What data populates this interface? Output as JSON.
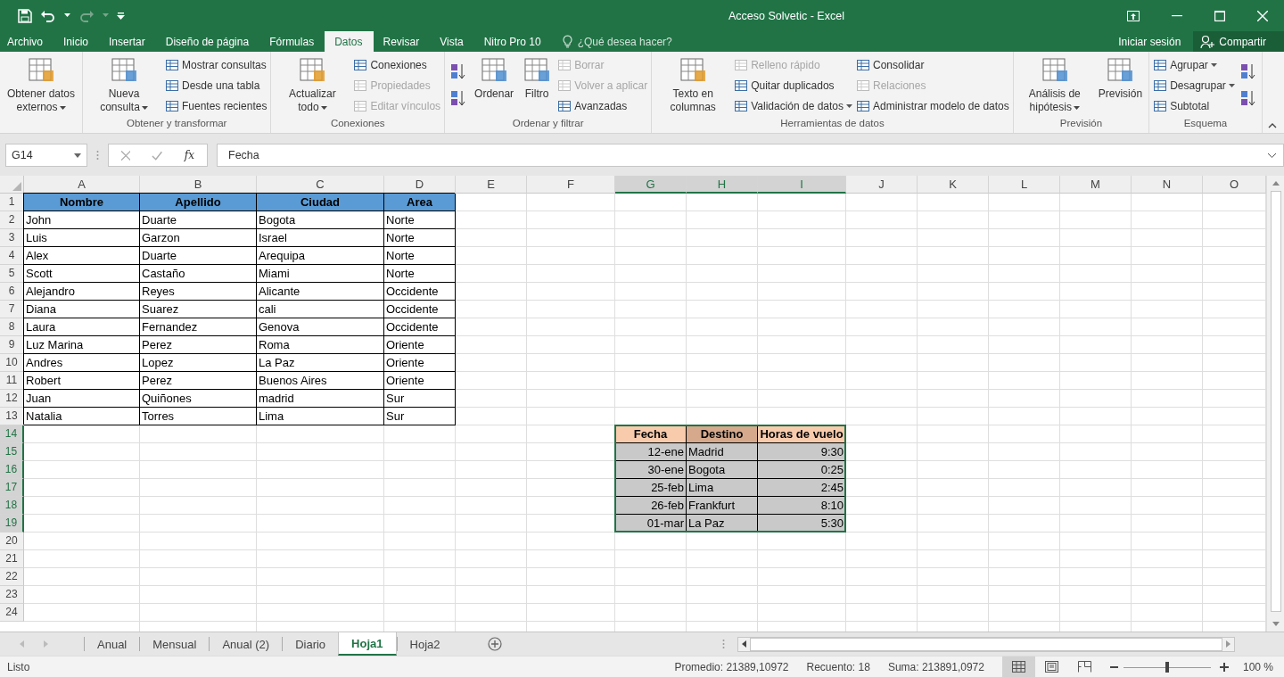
{
  "window": {
    "title": "Acceso Solvetic - Excel"
  },
  "ribbon_tabs": [
    {
      "label": "Archivo",
      "selected": false
    },
    {
      "label": "Inicio",
      "selected": false
    },
    {
      "label": "Insertar",
      "selected": false
    },
    {
      "label": "Diseño de página",
      "selected": false
    },
    {
      "label": "Fórmulas",
      "selected": false
    },
    {
      "label": "Datos",
      "selected": true
    },
    {
      "label": "Revisar",
      "selected": false
    },
    {
      "label": "Vista",
      "selected": false
    },
    {
      "label": "Nitro Pro 10",
      "selected": false
    }
  ],
  "tell_me": {
    "placeholder": "¿Qué desea hacer?"
  },
  "account": {
    "sign_in": "Iniciar sesión",
    "share": "Compartir"
  },
  "ribbon_groups": [
    {
      "columns": [
        {
          "kind": "large",
          "label": "Obtener datos externos",
          "dropdown": true,
          "disabled": false
        }
      ]
    },
    {
      "label": "Obtener y transformar",
      "columns": [
        {
          "kind": "large",
          "label": "Nueva consulta",
          "dropdown": true,
          "disabled": false
        },
        {
          "kind": "stack",
          "items": [
            {
              "label": "Mostrar consultas",
              "disabled": false,
              "dropdown": false
            },
            {
              "label": "Desde una tabla",
              "disabled": false,
              "dropdown": false
            },
            {
              "label": "Fuentes recientes",
              "disabled": false,
              "dropdown": false
            }
          ]
        }
      ]
    },
    {
      "label": "Conexiones",
      "columns": [
        {
          "kind": "large",
          "label": "Actualizar todo",
          "dropdown": true,
          "disabled": false
        },
        {
          "kind": "stack",
          "items": [
            {
              "label": "Conexiones",
              "disabled": false,
              "dropdown": false
            },
            {
              "label": "Propiedades",
              "disabled": true,
              "dropdown": false
            },
            {
              "label": "Editar vínculos",
              "disabled": true,
              "dropdown": false
            }
          ]
        }
      ]
    },
    {
      "label": "Ordenar y filtrar",
      "columns": [
        {
          "kind": "icons"
        },
        {
          "kind": "large",
          "label": "Ordenar",
          "dropdown": false,
          "disabled": false
        },
        {
          "kind": "large",
          "label": "Filtro",
          "dropdown": false,
          "disabled": false
        },
        {
          "kind": "stack",
          "items": [
            {
              "label": "Borrar",
              "disabled": true,
              "dropdown": false
            },
            {
              "label": "Volver a aplicar",
              "disabled": true,
              "dropdown": false
            },
            {
              "label": "Avanzadas",
              "disabled": false,
              "dropdown": false
            }
          ]
        }
      ]
    },
    {
      "label": "Herramientas de datos",
      "columns": [
        {
          "kind": "large",
          "label": "Texto en columnas",
          "dropdown": false,
          "disabled": false
        },
        {
          "kind": "stack",
          "items": [
            {
              "label": "Relleno rápido",
              "disabled": true,
              "dropdown": false
            },
            {
              "label": "Quitar duplicados",
              "disabled": false,
              "dropdown": false
            },
            {
              "label": "Validación de datos",
              "disabled": false,
              "dropdown": true
            }
          ]
        },
        {
          "kind": "stack",
          "items": [
            {
              "label": "Consolidar",
              "disabled": false,
              "dropdown": false
            },
            {
              "label": "Relaciones",
              "disabled": true,
              "dropdown": false
            },
            {
              "label": "Administrar modelo de datos",
              "disabled": false,
              "dropdown": false
            }
          ]
        }
      ]
    },
    {
      "label": "Previsión",
      "columns": [
        {
          "kind": "large",
          "label": "Análisis de hipótesis",
          "dropdown": true,
          "disabled": false
        },
        {
          "kind": "large",
          "label": "Previsión",
          "dropdown": false,
          "disabled": false
        }
      ]
    },
    {
      "label": "Esquema",
      "columns": [
        {
          "kind": "stack",
          "items": [
            {
              "label": "Agrupar",
              "disabled": false,
              "dropdown": true
            },
            {
              "label": "Desagrupar",
              "disabled": false,
              "dropdown": true
            },
            {
              "label": "Subtotal",
              "disabled": false,
              "dropdown": false
            }
          ]
        },
        {
          "kind": "icons"
        }
      ]
    }
  ],
  "formula_bar": {
    "name_box": "G14",
    "function_label": "fx",
    "value": "Fecha"
  },
  "sheet": {
    "columns": [
      {
        "label": "A",
        "selected": false
      },
      {
        "label": "B",
        "selected": false
      },
      {
        "label": "C",
        "selected": false
      },
      {
        "label": "D",
        "selected": false
      },
      {
        "label": "E",
        "selected": false
      },
      {
        "label": "F",
        "selected": false
      },
      {
        "label": "G",
        "selected": true
      },
      {
        "label": "H",
        "selected": true
      },
      {
        "label": "I",
        "selected": true
      },
      {
        "label": "J",
        "selected": false
      },
      {
        "label": "K",
        "selected": false
      },
      {
        "label": "L",
        "selected": false
      },
      {
        "label": "M",
        "selected": false
      },
      {
        "label": "N",
        "selected": false
      },
      {
        "label": "O",
        "selected": false
      }
    ],
    "rows": [
      {
        "number": "1",
        "selected": false,
        "cells": {
          "A": {
            "text": "Nombre",
            "kind": "header",
            "color": "#5b9bd5"
          },
          "B": {
            "text": "Apellido",
            "kind": "header",
            "color": "#5b9bd5"
          },
          "C": {
            "text": "Ciudad",
            "kind": "header",
            "color": "#5b9bd5"
          },
          "D": {
            "text": "Area",
            "kind": "header",
            "color": "#5b9bd5"
          }
        }
      },
      {
        "number": "2",
        "selected": false,
        "cells": {
          "A": {
            "text": "John",
            "kind": "text"
          },
          "B": {
            "text": "Duarte",
            "kind": "text"
          },
          "C": {
            "text": "Bogota",
            "kind": "text"
          },
          "D": {
            "text": "Norte",
            "kind": "text"
          }
        }
      },
      {
        "number": "3",
        "selected": false,
        "cells": {
          "A": {
            "text": "Luis",
            "kind": "text"
          },
          "B": {
            "text": "Garzon",
            "kind": "text"
          },
          "C": {
            "text": "Israel",
            "kind": "text"
          },
          "D": {
            "text": "Norte",
            "kind": "text"
          }
        }
      },
      {
        "number": "4",
        "selected": false,
        "cells": {
          "A": {
            "text": "Alex",
            "kind": "text"
          },
          "B": {
            "text": "Duarte",
            "kind": "text"
          },
          "C": {
            "text": "Arequipa",
            "kind": "text"
          },
          "D": {
            "text": "Norte",
            "kind": "text"
          }
        }
      },
      {
        "number": "5",
        "selected": false,
        "cells": {
          "A": {
            "text": "Scott",
            "kind": "text"
          },
          "B": {
            "text": "Castaño",
            "kind": "text"
          },
          "C": {
            "text": "Miami",
            "kind": "text"
          },
          "D": {
            "text": "Norte",
            "kind": "text"
          }
        }
      },
      {
        "number": "6",
        "selected": false,
        "cells": {
          "A": {
            "text": "Alejandro",
            "kind": "text"
          },
          "B": {
            "text": "Reyes",
            "kind": "text"
          },
          "C": {
            "text": "Alicante",
            "kind": "text"
          },
          "D": {
            "text": "Occidente",
            "kind": "text"
          }
        }
      },
      {
        "number": "7",
        "selected": false,
        "cells": {
          "A": {
            "text": "Diana",
            "kind": "text"
          },
          "B": {
            "text": "Suarez",
            "kind": "text"
          },
          "C": {
            "text": "cali",
            "kind": "text"
          },
          "D": {
            "text": "Occidente",
            "kind": "text"
          }
        }
      },
      {
        "number": "8",
        "selected": false,
        "cells": {
          "A": {
            "text": "Laura",
            "kind": "text"
          },
          "B": {
            "text": "Fernandez",
            "kind": "text"
          },
          "C": {
            "text": "Genova",
            "kind": "text"
          },
          "D": {
            "text": "Occidente",
            "kind": "text"
          }
        }
      },
      {
        "number": "9",
        "selected": false,
        "cells": {
          "A": {
            "text": "Luz Marina",
            "kind": "text"
          },
          "B": {
            "text": "Perez",
            "kind": "text"
          },
          "C": {
            "text": "Roma",
            "kind": "text"
          },
          "D": {
            "text": "Oriente",
            "kind": "text"
          }
        }
      },
      {
        "number": "10",
        "selected": false,
        "cells": {
          "A": {
            "text": "Andres",
            "kind": "text"
          },
          "B": {
            "text": "Lopez",
            "kind": "text"
          },
          "C": {
            "text": "La Paz",
            "kind": "text"
          },
          "D": {
            "text": "Oriente",
            "kind": "text"
          }
        }
      },
      {
        "number": "11",
        "selected": false,
        "cells": {
          "A": {
            "text": "Robert",
            "kind": "text"
          },
          "B": {
            "text": "Perez",
            "kind": "text"
          },
          "C": {
            "text": "Buenos Aires",
            "kind": "text"
          },
          "D": {
            "text": "Oriente",
            "kind": "text"
          }
        }
      },
      {
        "number": "12",
        "selected": false,
        "cells": {
          "A": {
            "text": "Juan",
            "kind": "text"
          },
          "B": {
            "text": "Quiñones",
            "kind": "text"
          },
          "C": {
            "text": "madrid",
            "kind": "text"
          },
          "D": {
            "text": "Sur",
            "kind": "text"
          }
        }
      },
      {
        "number": "13",
        "selected": false,
        "cells": {
          "A": {
            "text": "Natalia",
            "kind": "text"
          },
          "B": {
            "text": "Torres",
            "kind": "text"
          },
          "C": {
            "text": "Lima",
            "kind": "text"
          },
          "D": {
            "text": "Sur",
            "kind": "text"
          }
        }
      },
      {
        "number": "14",
        "selected": true,
        "cells": {
          "G": {
            "text": "Fecha",
            "kind": "header",
            "color": "#f8cbad"
          },
          "H": {
            "text": "Destino",
            "kind": "header",
            "color": "#d6a98c"
          },
          "I": {
            "text": "Horas de vuelo",
            "kind": "header",
            "color": "#f8cbad"
          }
        }
      },
      {
        "number": "15",
        "selected": true,
        "cells": {
          "G": {
            "text": "12-ene",
            "kind": "number",
            "color": "#c9c9c9"
          },
          "H": {
            "text": "Madrid",
            "kind": "text",
            "color": "#c9c9c9"
          },
          "I": {
            "text": "9:30",
            "kind": "number",
            "color": "#c9c9c9"
          }
        }
      },
      {
        "number": "16",
        "selected": true,
        "cells": {
          "G": {
            "text": "30-ene",
            "kind": "number",
            "color": "#c9c9c9"
          },
          "H": {
            "text": "Bogota",
            "kind": "text",
            "color": "#c9c9c9"
          },
          "I": {
            "text": "0:25",
            "kind": "number",
            "color": "#c9c9c9"
          }
        }
      },
      {
        "number": "17",
        "selected": true,
        "cells": {
          "G": {
            "text": "25-feb",
            "kind": "number",
            "color": "#c9c9c9"
          },
          "H": {
            "text": "Lima",
            "kind": "text",
            "color": "#c9c9c9"
          },
          "I": {
            "text": "2:45",
            "kind": "number",
            "color": "#c9c9c9"
          }
        }
      },
      {
        "number": "18",
        "selected": true,
        "cells": {
          "G": {
            "text": "26-feb",
            "kind": "number",
            "color": "#c9c9c9"
          },
          "H": {
            "text": "Frankfurt",
            "kind": "text",
            "color": "#c9c9c9"
          },
          "I": {
            "text": "8:10",
            "kind": "number",
            "color": "#c9c9c9"
          }
        }
      },
      {
        "number": "19",
        "selected": true,
        "cells": {
          "G": {
            "text": "01-mar",
            "kind": "number",
            "color": "#c9c9c9"
          },
          "H": {
            "text": "La Paz",
            "kind": "text",
            "color": "#c9c9c9"
          },
          "I": {
            "text": "5:30",
            "kind": "number",
            "color": "#c9c9c9"
          }
        }
      },
      {
        "number": "20",
        "selected": false
      },
      {
        "number": "21",
        "selected": false
      },
      {
        "number": "22",
        "selected": false
      },
      {
        "number": "23",
        "selected": false
      },
      {
        "number": "24",
        "selected": false
      }
    ]
  },
  "sheet_tabs": [
    {
      "label": "Anual",
      "selected": false
    },
    {
      "label": "Mensual",
      "selected": false
    },
    {
      "label": "Anual (2)",
      "selected": false
    },
    {
      "label": "Diario",
      "selected": false
    },
    {
      "label": "Hoja1",
      "selected": true
    },
    {
      "label": "Hoja2",
      "selected": false
    }
  ],
  "status_bar": {
    "state": "Listo",
    "stats": [
      "Promedio: 21389,10972",
      "Recuento: 18",
      "Suma: 213891,0972"
    ],
    "views": [
      {
        "selected": true
      },
      {
        "selected": false
      },
      {
        "selected": false
      }
    ],
    "zoom": {
      "level": 0.5,
      "label": "100 %"
    }
  }
}
